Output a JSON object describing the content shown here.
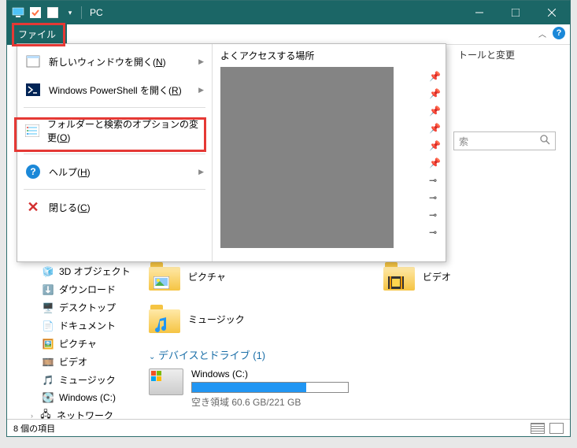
{
  "titlebar": {
    "title": "PC"
  },
  "tabs": {
    "file": "ファイル"
  },
  "file_menu": {
    "items": [
      {
        "label": "新しいウィンドウを開く(N)",
        "key": "N",
        "has_arrow": true
      },
      {
        "label": "Windows PowerShell を開く(R)",
        "key": "R",
        "has_arrow": true
      },
      {
        "label": "フォルダーと検索のオプションの変更(O)",
        "key": "O",
        "has_arrow": false
      },
      {
        "label": "ヘルプ(H)",
        "key": "H",
        "has_arrow": true
      },
      {
        "label": "閉じる(C)",
        "key": "C",
        "has_arrow": false
      }
    ],
    "right_title": "よくアクセスする場所"
  },
  "bg": {
    "install_text": "トールと変更",
    "search_placeholder": "索"
  },
  "tree": {
    "items": [
      "3D オブジェクト",
      "ダウンロード",
      "デスクトップ",
      "ドキュメント",
      "ピクチャ",
      "ビデオ",
      "ミュージック",
      "Windows (C:)",
      "ネットワーク"
    ]
  },
  "folders": {
    "row1": [
      "ピクチャ",
      "ビデオ"
    ],
    "row2": [
      "ミュージック"
    ]
  },
  "drives": {
    "header": "デバイスとドライブ (1)",
    "name": "Windows (C:)",
    "free_text": "空き領域 60.6 GB/221 GB",
    "fill_pct": 73
  },
  "status": {
    "text": "8 個の項目"
  }
}
